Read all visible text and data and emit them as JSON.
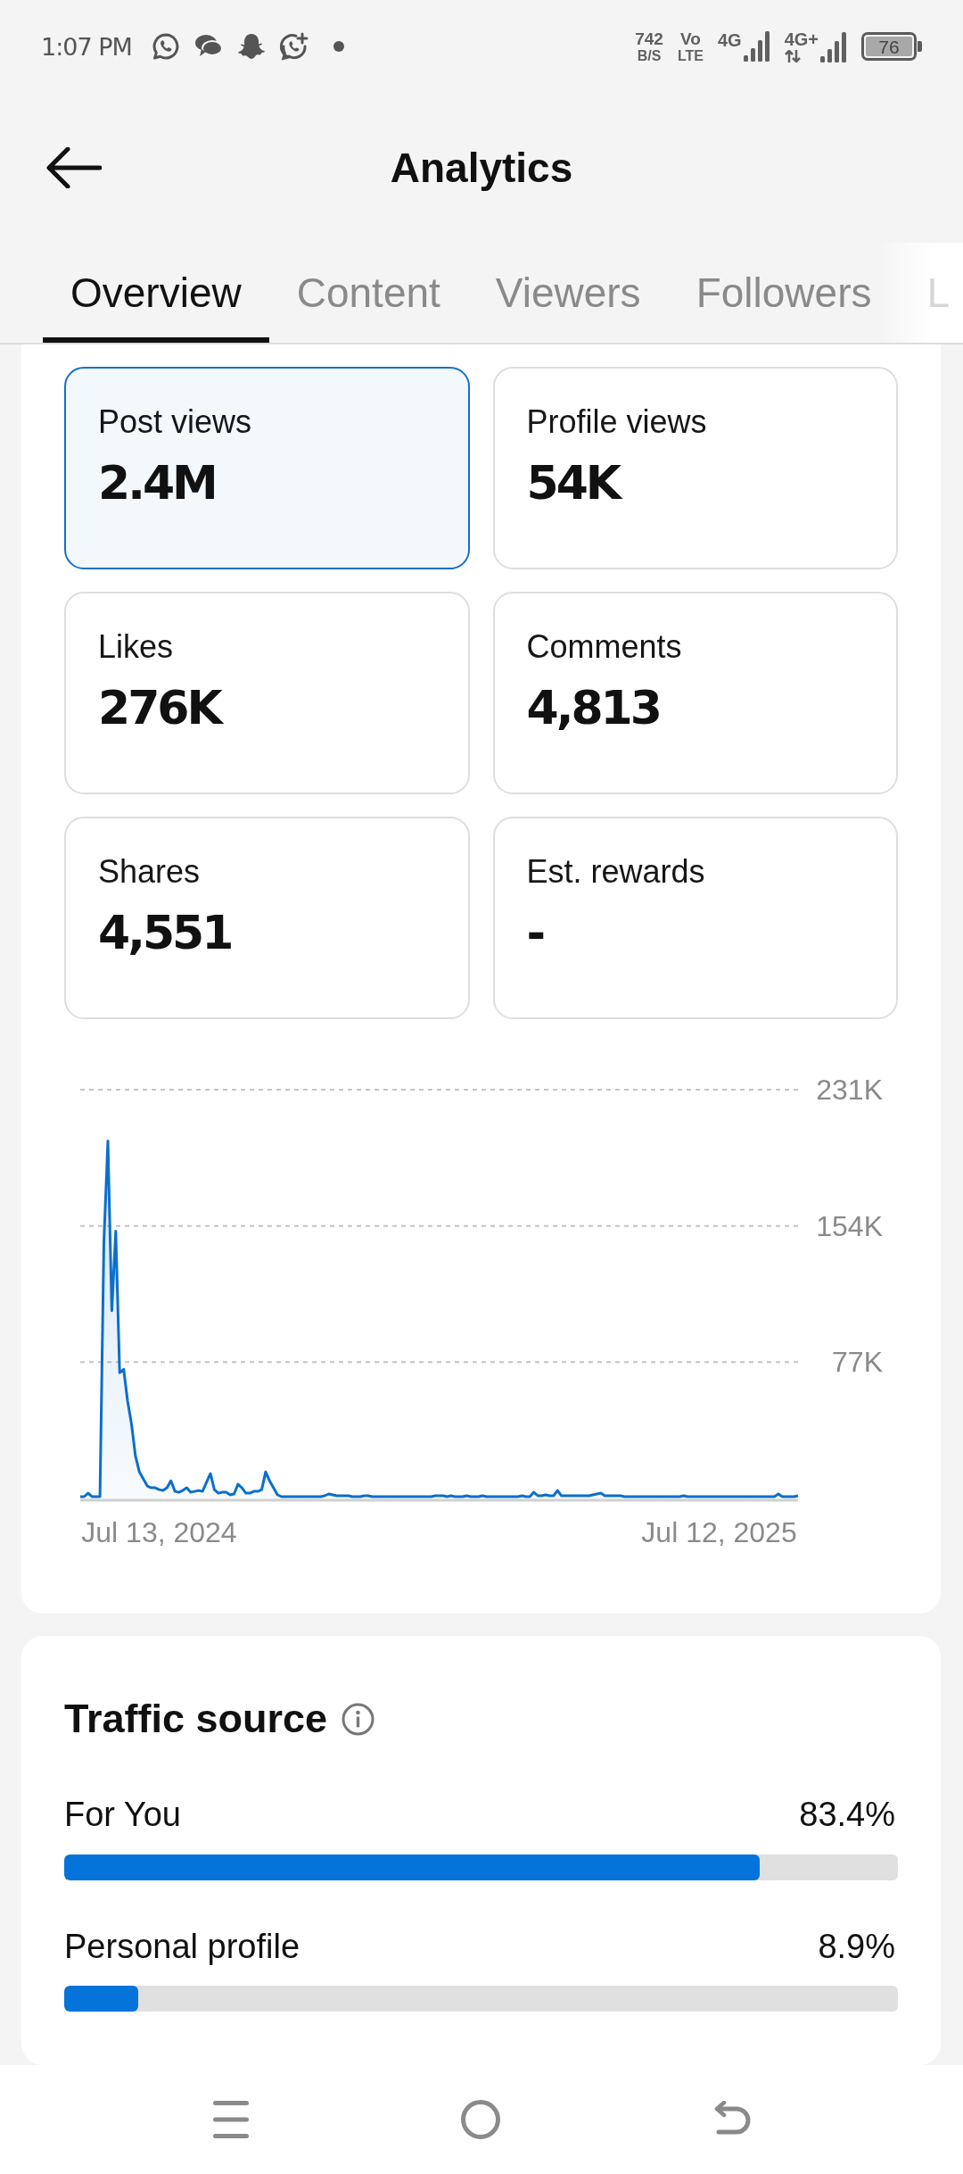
{
  "status_bar": {
    "time": "1:07 PM",
    "net_speed": "742",
    "net_speed_unit": "B/S",
    "volte_top": "Vo",
    "volte_bottom": "LTE",
    "sim1": "4G",
    "sim2": "4G+",
    "battery": "76"
  },
  "header": {
    "title": "Analytics"
  },
  "tabs": [
    {
      "label": "Overview",
      "selected": true
    },
    {
      "label": "Content",
      "selected": false
    },
    {
      "label": "Viewers",
      "selected": false
    },
    {
      "label": "Followers",
      "selected": false
    },
    {
      "label": "L",
      "selected": false
    }
  ],
  "metrics": [
    {
      "label": "Post views",
      "value": "2.4M",
      "selected": true
    },
    {
      "label": "Profile views",
      "value": "54K",
      "selected": false
    },
    {
      "label": "Likes",
      "value": "276K",
      "selected": false
    },
    {
      "label": "Comments",
      "value": "4,813",
      "selected": false
    },
    {
      "label": "Shares",
      "value": "4,551",
      "selected": false
    },
    {
      "label": "Est. rewards",
      "value": "-",
      "selected": false
    }
  ],
  "chart": {
    "chart_data": {
      "type": "area",
      "categories": [
        null,
        null,
        null,
        null,
        null,
        null,
        null,
        null,
        null,
        null,
        null,
        null,
        null,
        null,
        null,
        null,
        null,
        null,
        null,
        null,
        "Jul 13, 2024",
        null,
        null,
        null,
        null,
        null,
        null,
        null,
        null,
        null,
        null,
        null,
        null,
        null,
        null,
        null,
        null,
        null,
        null,
        null,
        null,
        null,
        null,
        null,
        null,
        null,
        null,
        null,
        null,
        null,
        null,
        null,
        null,
        null,
        null,
        null,
        null,
        null,
        null,
        null,
        null,
        null,
        null,
        null,
        null,
        null,
        null,
        null,
        null,
        null,
        null,
        null,
        null,
        null,
        null,
        null,
        null,
        null,
        null,
        null,
        null,
        null,
        null,
        null,
        null,
        null,
        null,
        null,
        null,
        null,
        null,
        null,
        null,
        null,
        null,
        null,
        null,
        null,
        null,
        null,
        null,
        null,
        null,
        null,
        null,
        null,
        null,
        null,
        null,
        null,
        null,
        null,
        null,
        null,
        null,
        null,
        null,
        null,
        null,
        null,
        null,
        null,
        null,
        null,
        null,
        null,
        null,
        null,
        null,
        null,
        null,
        null,
        null,
        null,
        null,
        null,
        null,
        null,
        null,
        null,
        null,
        null,
        null,
        null,
        null,
        null,
        null,
        null,
        null,
        null,
        null,
        null,
        null,
        null,
        null,
        null,
        null,
        null,
        null,
        null,
        null,
        null,
        "Jul 12, 2025",
        null,
        null,
        null,
        null,
        null,
        null,
        null,
        null,
        null,
        null,
        null,
        null,
        null,
        null,
        null,
        null,
        null,
        null,
        null,
        null
      ],
      "series": [
        {
          "color": "#0b6fcc",
          "values": [
            1000,
            1000,
            3000,
            1000,
            1000,
            1000,
            145000,
            202000,
            106000,
            151000,
            71000,
            73000,
            55000,
            42000,
            24000,
            15000,
            11000,
            7000,
            6000,
            6000,
            5000,
            4500,
            6000,
            10000,
            4000,
            3500,
            4500,
            6000,
            3500,
            4000,
            4500,
            4000,
            9000,
            14000,
            5000,
            3000,
            3500,
            3500,
            2000,
            2500,
            8000,
            6000,
            3000,
            3000,
            4000,
            4000,
            5000,
            15000,
            10000,
            6000,
            2000,
            1000,
            1000,
            1000,
            1000,
            1000,
            1000,
            1000,
            1000,
            1000,
            1000,
            1000,
            1500,
            2500,
            2000,
            1500,
            1500,
            1500,
            1500,
            1000,
            1000,
            1000,
            1500,
            1500,
            1000,
            1000,
            1000,
            1000,
            1000,
            1000,
            1000,
            1000,
            1000,
            1000,
            1000,
            1000,
            1000,
            1000,
            1000,
            1000,
            1500,
            1500,
            1500,
            1000,
            1500,
            1000,
            1000,
            1000,
            1500,
            1000,
            1000,
            1000,
            1500,
            1000,
            1000,
            1000,
            1000,
            1000,
            1000,
            1000,
            1000,
            1000,
            1500,
            1000,
            1000,
            3500,
            1500,
            1500,
            2000,
            1500,
            1500,
            4500,
            1500,
            1500,
            1500,
            1500,
            1500,
            1500,
            1500,
            1500,
            2000,
            2500,
            3000,
            1500,
            1500,
            1500,
            1500,
            1500,
            1000,
            1000,
            1000,
            1000,
            1000,
            1000,
            1000,
            1000,
            1000,
            1000,
            1000,
            1000,
            1000,
            1000,
            1000,
            1500,
            1000,
            1000,
            1000,
            1000,
            1000,
            1000,
            1000,
            1000,
            1000,
            1000,
            1000,
            1000,
            1000,
            1000,
            1000,
            1000,
            1000,
            1000,
            1000,
            1000,
            1000,
            1000,
            1000,
            2500,
            1000,
            1000,
            1000,
            1000,
            1500
          ]
        }
      ],
      "ylim": [
        0,
        231000
      ],
      "yticks": [
        {
          "value": 77000,
          "label": "77K"
        },
        {
          "value": 154000,
          "label": "154K"
        },
        {
          "value": 231000,
          "label": "231K"
        }
      ]
    }
  },
  "traffic_source": {
    "title": "Traffic source",
    "sources": [
      {
        "name": "For You",
        "reading": "83.4%",
        "level": 0.834
      },
      {
        "name": "Personal profile",
        "reading": "8.9%",
        "level": 0.089
      }
    ]
  }
}
